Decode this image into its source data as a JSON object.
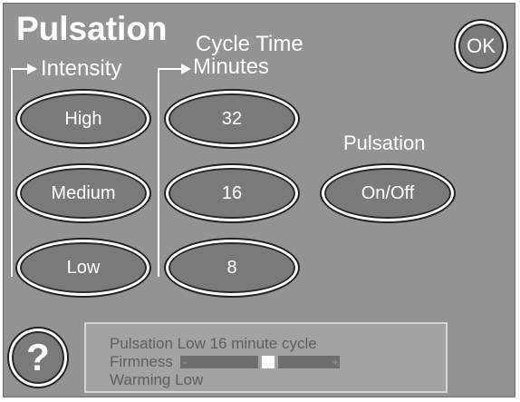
{
  "title": "Pulsation",
  "ok_label": "OK",
  "help_label": "?",
  "intensity": {
    "label": "Intensity",
    "options": [
      "High",
      "Medium",
      "Low"
    ]
  },
  "cycle_time": {
    "label_line1": "Cycle Time",
    "label_line2": "Minutes",
    "options": [
      "32",
      "16",
      "8"
    ]
  },
  "pulsation_toggle": {
    "label": "Pulsation",
    "button_label": "On/Off"
  },
  "status": {
    "line1": "Pulsation Low  16 minute cycle",
    "firmness_label": "Firmness",
    "firmness_minus": "-",
    "firmness_plus": "+",
    "firmness_level": 0.55,
    "line3": "Warming Low"
  },
  "colors": {
    "panel": "#939393",
    "button_fill": "#7a7a7a",
    "text": "#ffffff",
    "status_text": "#5e5e5e"
  }
}
